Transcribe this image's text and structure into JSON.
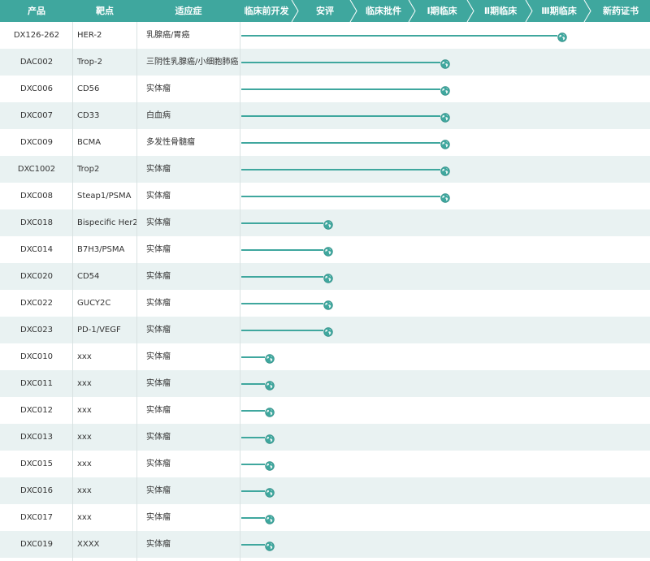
{
  "colors": {
    "accent": "#3fa79e",
    "row_alt": "#e9f2f2",
    "text": "#333333"
  },
  "header": {
    "product": "产品",
    "target": "靶点",
    "indication": "适应症",
    "stages": [
      "临床前开发",
      "安评",
      "临床批件",
      "Ⅰ期临床",
      "Ⅱ期临床",
      "Ⅲ期临床",
      "新药证书"
    ]
  },
  "marker_icon": "globe-icon",
  "rows": [
    {
      "product": "DX126-262",
      "target": "HER-2",
      "indication": "乳腺癌/胃癌",
      "stage_progress": 5.5
    },
    {
      "product": "DAC002",
      "target": "Trop-2",
      "indication": "三阴性乳腺癌/小细胞肺癌",
      "stage_progress": 3.5
    },
    {
      "product": "DXC006",
      "target": "CD56",
      "indication": "实体瘤",
      "stage_progress": 3.5
    },
    {
      "product": "DXC007",
      "target": "CD33",
      "indication": "白血病",
      "stage_progress": 3.5
    },
    {
      "product": "DXC009",
      "target": "BCMA",
      "indication": "多发性骨髓瘤",
      "stage_progress": 3.5
    },
    {
      "product": "DXC1002",
      "target": "Trop2",
      "indication": "实体瘤",
      "stage_progress": 3.5
    },
    {
      "product": "DXC008",
      "target": "Steap1/PSMA",
      "indication": "实体瘤",
      "stage_progress": 3.5
    },
    {
      "product": "DXC018",
      "target": "Bispecific Her2",
      "indication": "实体瘤",
      "stage_progress": 1.5
    },
    {
      "product": "DXC014",
      "target": "B7H3/PSMA",
      "indication": "实体瘤",
      "stage_progress": 1.5
    },
    {
      "product": "DXC020",
      "target": "CD54",
      "indication": "实体瘤",
      "stage_progress": 1.5
    },
    {
      "product": "DXC022",
      "target": "GUCY2C",
      "indication": "实体瘤",
      "stage_progress": 1.5
    },
    {
      "product": "DXC023",
      "target": "PD-1/VEGF",
      "indication": "实体瘤",
      "stage_progress": 1.5
    },
    {
      "product": "DXC010",
      "target": "xxx",
      "indication": "实体瘤",
      "stage_progress": 0.5
    },
    {
      "product": "DXC011",
      "target": "xxx",
      "indication": "实体瘤",
      "stage_progress": 0.5
    },
    {
      "product": "DXC012",
      "target": "xxx",
      "indication": "实体瘤",
      "stage_progress": 0.5
    },
    {
      "product": "DXC013",
      "target": "xxx",
      "indication": "实体瘤",
      "stage_progress": 0.5
    },
    {
      "product": "DXC015",
      "target": "xxx",
      "indication": "实体瘤",
      "stage_progress": 0.5
    },
    {
      "product": "DXC016",
      "target": "xxx",
      "indication": "实体瘤",
      "stage_progress": 0.5
    },
    {
      "product": "DXC017",
      "target": "xxx",
      "indication": "实体瘤",
      "stage_progress": 0.5
    },
    {
      "product": "DXC019",
      "target": "XXXX",
      "indication": "实体瘤",
      "stage_progress": 0.5
    }
  ]
}
